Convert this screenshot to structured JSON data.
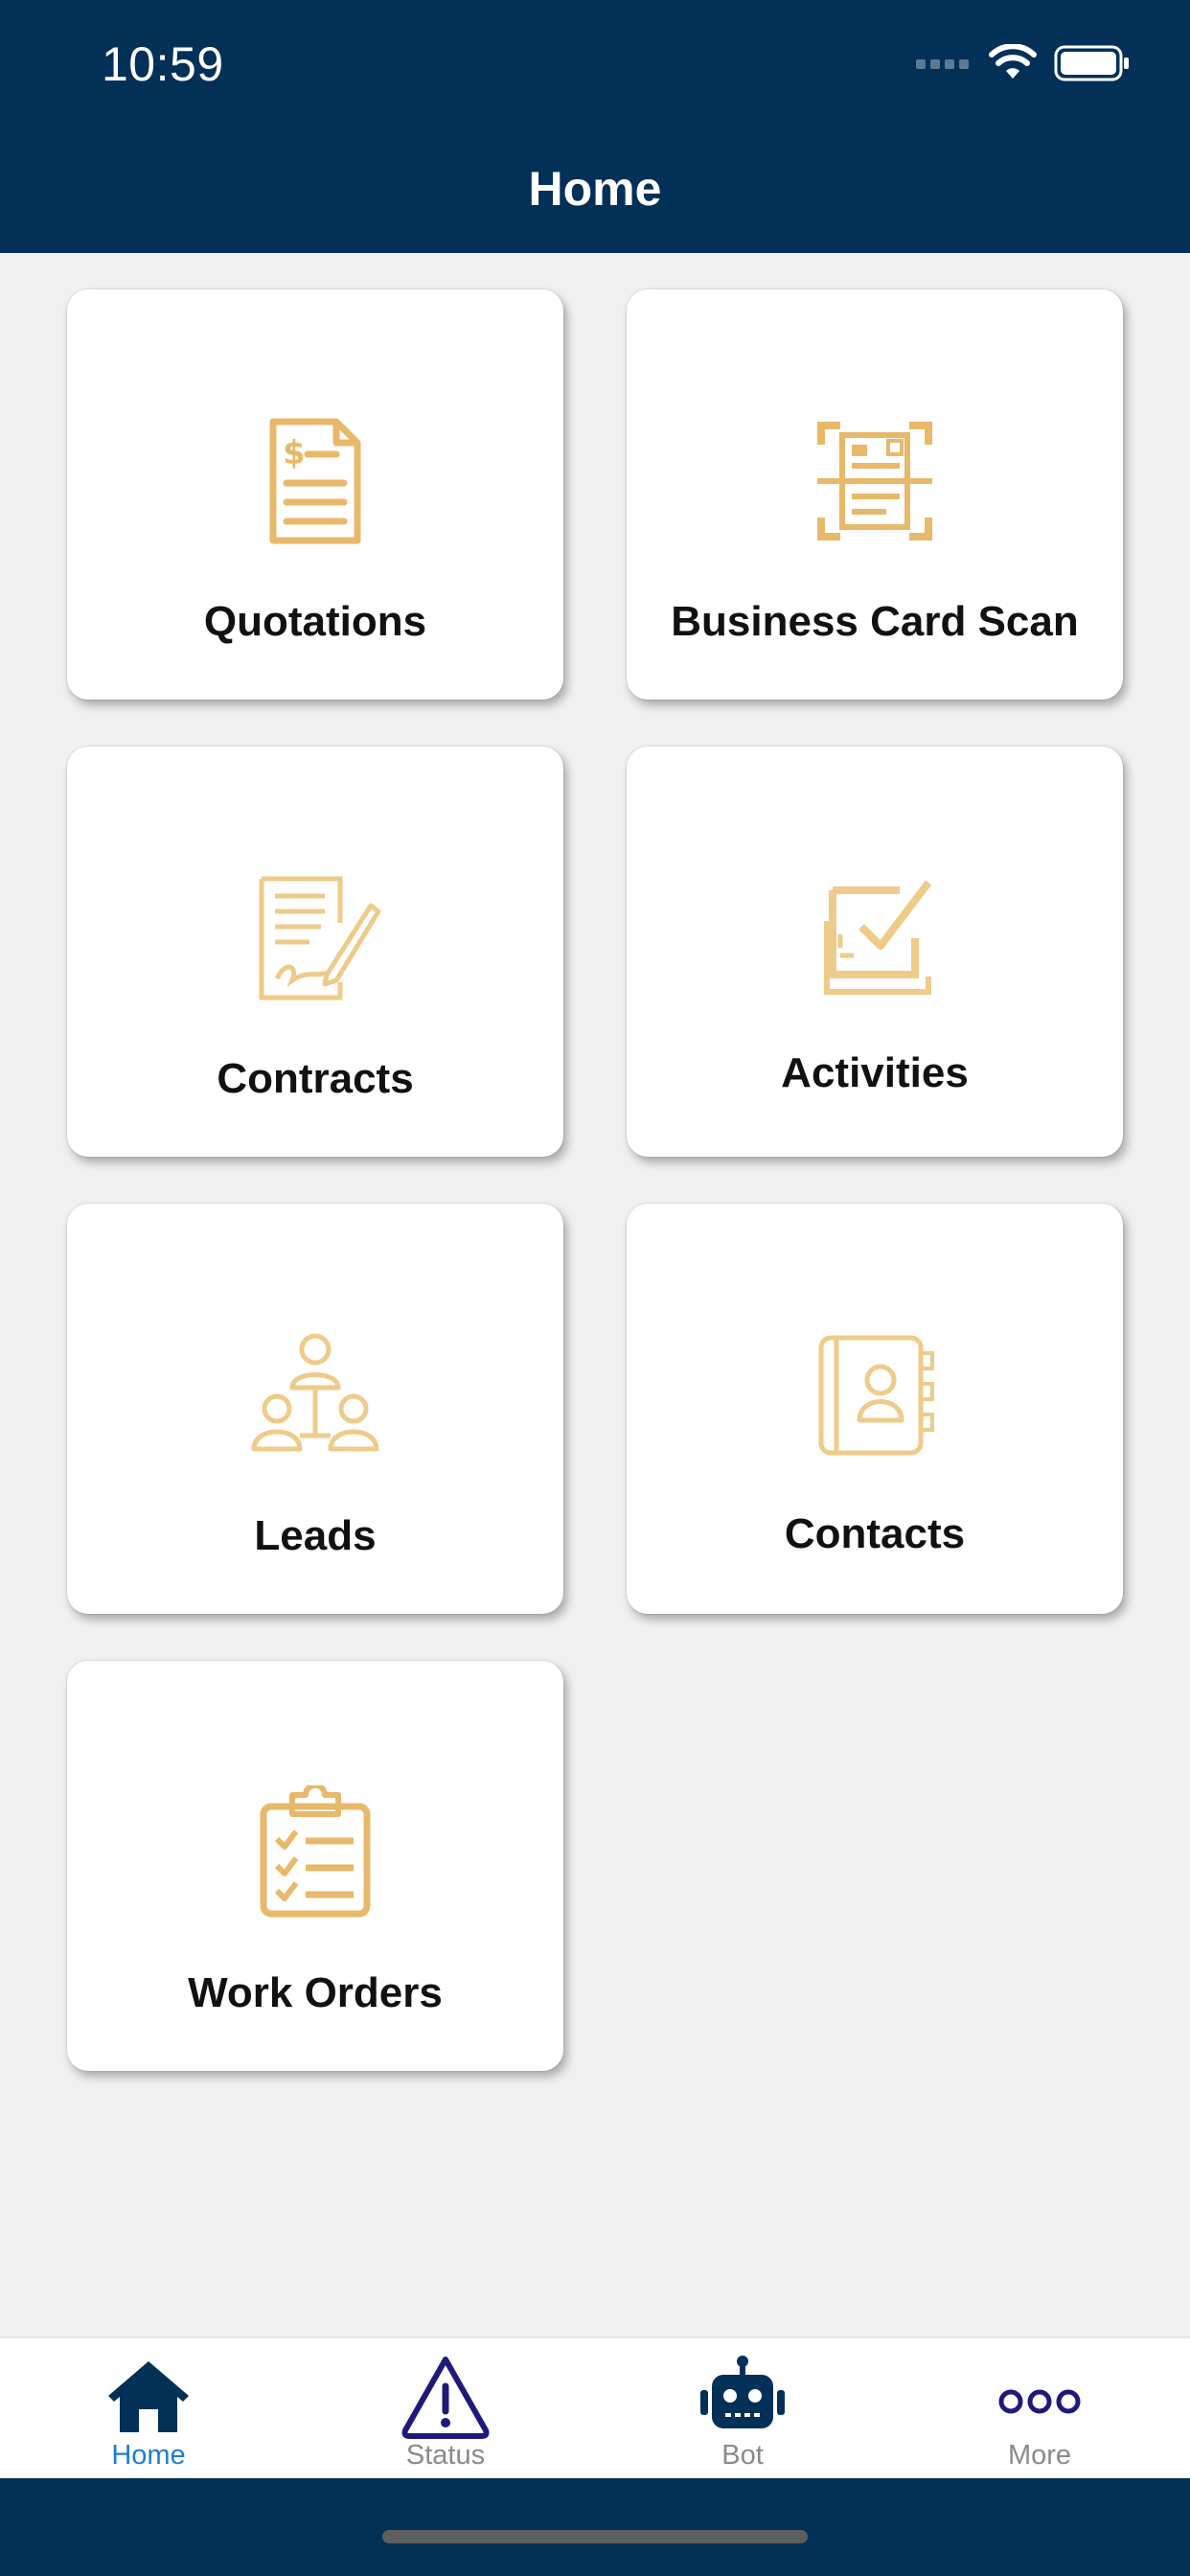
{
  "status_bar": {
    "time": "10:59",
    "icons": [
      "signal-icon",
      "wifi-icon",
      "battery-icon"
    ]
  },
  "header": {
    "title": "Home"
  },
  "tiles": [
    {
      "label": "Quotations",
      "icon": "quotation-document-icon"
    },
    {
      "label": "Business Card Scan",
      "icon": "card-scan-icon"
    },
    {
      "label": "Contracts",
      "icon": "contract-sign-icon"
    },
    {
      "label": "Activities",
      "icon": "activity-check-icon"
    },
    {
      "label": "Leads",
      "icon": "leads-hierarchy-icon"
    },
    {
      "label": "Contacts",
      "icon": "contacts-book-icon"
    },
    {
      "label": "Work Orders",
      "icon": "clipboard-checklist-icon"
    }
  ],
  "tabbar": {
    "items": [
      {
        "label": "Home",
        "icon": "home-icon",
        "active": true
      },
      {
        "label": "Status",
        "icon": "warning-icon",
        "active": false
      },
      {
        "label": "Bot",
        "icon": "robot-icon",
        "active": false
      },
      {
        "label": "More",
        "icon": "more-dots-icon",
        "active": false
      }
    ]
  },
  "colors": {
    "header_bg": "#023057",
    "icon_gold": "#E8B96A",
    "tab_active": "#1A7FD0",
    "tab_inactive": "#8A8A8A",
    "tab_icon_dark": "#023057",
    "tab_icon_purple": "#1F1A7A",
    "page_bg": "#F1F1F1"
  }
}
